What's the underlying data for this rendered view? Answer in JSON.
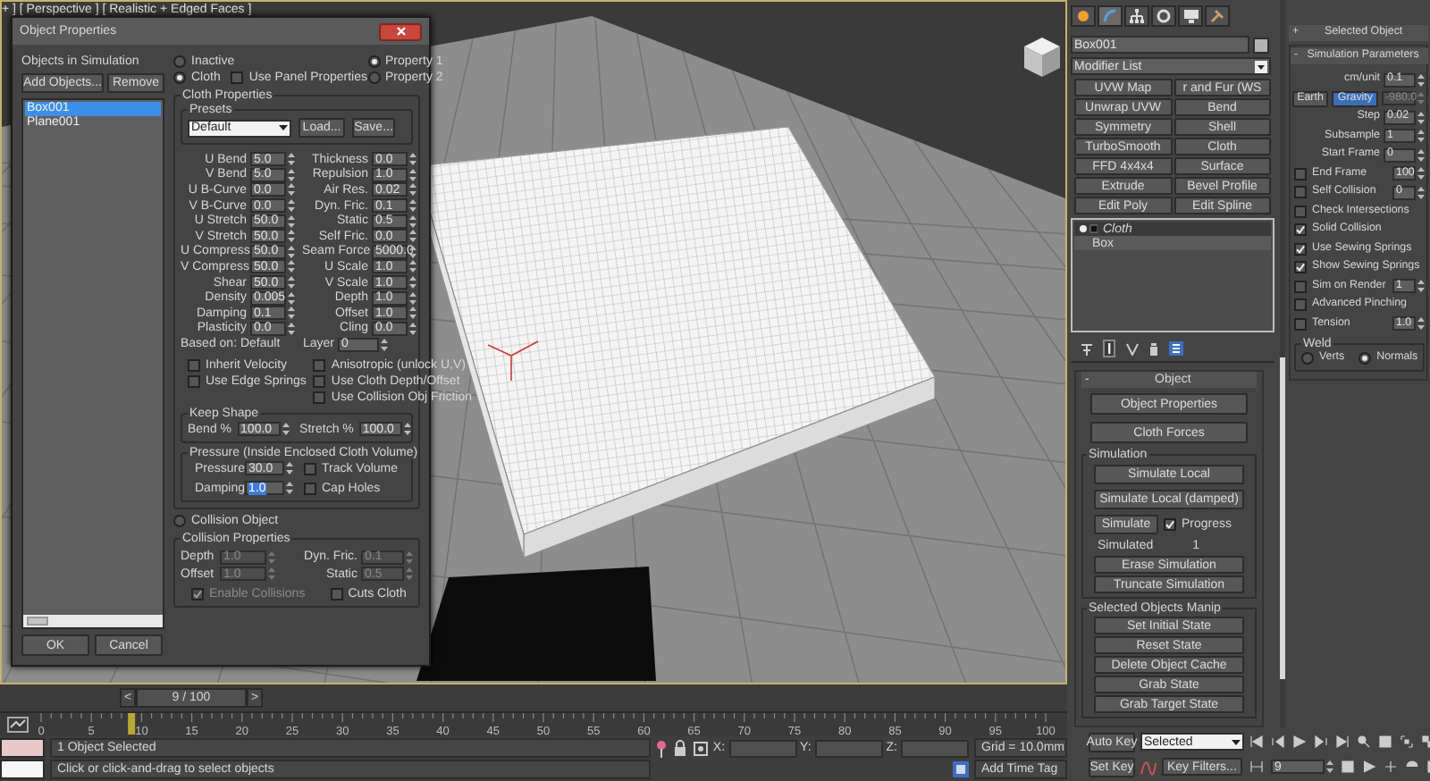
{
  "viewport": {
    "label": "+ ] [ Perspective ] [ Realistic + Edged Faces ]"
  },
  "dialog": {
    "title": "Object Properties",
    "objects_label": "Objects in Simulation",
    "add_button": "Add Objects...",
    "remove_button": "Remove",
    "objects": [
      {
        "label": "Box001",
        "selected": true
      },
      {
        "label": "Plane001",
        "selected": false
      }
    ],
    "ok": "OK",
    "cancel": "Cancel",
    "mode_options": [
      {
        "label": "Inactive",
        "selected": false
      },
      {
        "label": "Cloth",
        "selected": true
      }
    ],
    "use_panel_properties": {
      "label": "Use Panel Properties",
      "checked": false
    },
    "property_options": [
      {
        "label": "Property 1",
        "selected": true
      },
      {
        "label": "Property 2",
        "selected": false
      }
    ],
    "cloth_properties": {
      "title": "Cloth Properties",
      "presets_title": "Presets",
      "preset": "Default",
      "load": "Load...",
      "save": "Save...",
      "left_params": [
        {
          "label": "U Bend",
          "value": "5.0"
        },
        {
          "label": "V Bend",
          "value": "5.0"
        },
        {
          "label": "U B-Curve",
          "value": "0.0"
        },
        {
          "label": "V B-Curve",
          "value": "0.0"
        },
        {
          "label": "U Stretch",
          "value": "50.0"
        },
        {
          "label": "V Stretch",
          "value": "50.0"
        },
        {
          "label": "U Compress",
          "value": "50.0"
        },
        {
          "label": "V Compress",
          "value": "50.0"
        },
        {
          "label": "Shear",
          "value": "50.0"
        },
        {
          "label": "Density",
          "value": "0.005"
        },
        {
          "label": "Damping",
          "value": "0.1"
        },
        {
          "label": "Plasticity",
          "value": "0.0"
        }
      ],
      "right_params": [
        {
          "label": "Thickness",
          "value": "0.0"
        },
        {
          "label": "Repulsion",
          "value": "1.0"
        },
        {
          "label": "Air Res.",
          "value": "0.02"
        },
        {
          "label": "Dyn. Fric.",
          "value": "0.1"
        },
        {
          "label": "Static",
          "value": "0.5"
        },
        {
          "label": "Self Fric.",
          "value": "0.0"
        },
        {
          "label": "Seam Force",
          "value": "5000.0"
        },
        {
          "label": "U Scale",
          "value": "1.0"
        },
        {
          "label": "V Scale",
          "value": "1.0"
        },
        {
          "label": "Depth",
          "value": "1.0"
        },
        {
          "label": "Offset",
          "value": "1.0"
        },
        {
          "label": "Cling",
          "value": "0.0"
        }
      ],
      "based_on": "Based on: Default",
      "layer_label": "Layer",
      "layer_value": "0",
      "left_options": [
        {
          "label": "Inherit Velocity",
          "checked": false
        },
        {
          "label": "Use Edge Springs",
          "checked": false
        }
      ],
      "right_options": [
        {
          "label": "Anisotropic (unlock U,V)",
          "checked": false
        },
        {
          "label": "Use Cloth Depth/Offset",
          "checked": false
        },
        {
          "label": "Use Collision Obj Friction",
          "checked": false
        }
      ],
      "keep_shape": {
        "title": "Keep Shape",
        "bend_label": "Bend %",
        "bend": "100.0",
        "stretch_label": "Stretch %",
        "stretch": "100.0"
      },
      "pressure": {
        "title": "Pressure (Inside Enclosed Cloth Volume)",
        "pressure_label": "Pressure",
        "pressure": "30.0",
        "damping_label": "Damping",
        "damping": "1.0",
        "damping_focused": true,
        "track_volume": {
          "label": "Track Volume",
          "checked": false
        },
        "cap_holes": {
          "label": "Cap Holes",
          "checked": false
        }
      }
    },
    "collision_object": {
      "label": "Collision Object",
      "selected": false
    },
    "collision_properties": {
      "title": "Collision Properties",
      "disabled": true,
      "params": [
        {
          "label": "Depth",
          "value": "1.0"
        },
        {
          "label": "Dyn. Fric.",
          "value": "0.1"
        },
        {
          "label": "Offset",
          "value": "1.0"
        },
        {
          "label": "Static",
          "value": "0.5"
        }
      ],
      "enable_collisions": {
        "label": "Enable Collisions",
        "checked": true
      },
      "cuts_cloth": {
        "label": "Cuts Cloth",
        "checked": false
      }
    }
  },
  "command_panel": {
    "tabs": [
      {
        "kind": "create",
        "selected": false
      },
      {
        "kind": "modify",
        "selected": true
      },
      {
        "kind": "hierarchy",
        "selected": false
      },
      {
        "kind": "motion",
        "selected": false
      },
      {
        "kind": "display",
        "selected": false
      },
      {
        "kind": "utilities",
        "selected": false
      }
    ],
    "object_name": "Box001",
    "modifier_list": "Modifier List",
    "modifier_buttons": [
      "UVW Map",
      "r and Fur (WS",
      "Unwrap UVW",
      "Bend",
      "Symmetry",
      "Shell",
      "TurboSmooth",
      "Cloth",
      "FFD 4x4x4",
      "Surface",
      "Extrude",
      "Bevel Profile",
      "Edit Poly",
      "Edit Spline"
    ],
    "stack": [
      {
        "label": "Cloth",
        "kind": "modifier"
      },
      {
        "label": "Box",
        "kind": "base"
      }
    ],
    "object_rollout": {
      "sign": "-",
      "title": "Object",
      "buttons": [
        "Object Properties",
        "Cloth Forces"
      ],
      "simulation_title": "Simulation",
      "simulate_local": "Simulate Local",
      "simulate_local_damped": "Simulate Local (damped)",
      "simulate": "Simulate",
      "progress": {
        "label": "Progress",
        "checked": true
      },
      "simulated_label": "Simulated",
      "simulated_value": "1",
      "sim_buttons": [
        "Erase Simulation",
        "Truncate Simulation"
      ],
      "manip_title": "Selected Objects Manip",
      "manip_buttons": [
        "Set Initial State",
        "Reset State",
        "Delete Object Cache",
        "Grab State",
        "Grab Target State"
      ]
    }
  },
  "sim_params": {
    "selected_object": {
      "sign": "+",
      "title": "Selected Object"
    },
    "sign": "-",
    "title": "Simulation Parameters",
    "cm_label": "cm/unit",
    "cm_value": "0.1",
    "earth": "Earth",
    "gravity": "Gravity",
    "gravity_on": true,
    "gravity_value": "-980.0",
    "rows": [
      {
        "kind": "spinner",
        "label": "Step",
        "value": "0.02"
      },
      {
        "kind": "spinner",
        "label": "Subsample",
        "value": "1"
      },
      {
        "kind": "spinner",
        "label": "Start Frame",
        "value": "0"
      },
      {
        "kind": "check_spinner",
        "label": "End Frame",
        "checked": false,
        "value": "100"
      },
      {
        "kind": "check_spinner",
        "label": "Self Collision",
        "checked": false,
        "value": "0"
      },
      {
        "kind": "check",
        "label": "Check Intersections",
        "checked": false
      },
      {
        "kind": "check",
        "label": "Solid Collision",
        "checked": true
      },
      {
        "kind": "check",
        "label": "Use Sewing Springs",
        "checked": true
      },
      {
        "kind": "check",
        "label": "Show Sewing Springs",
        "checked": true
      },
      {
        "kind": "check_spinner",
        "label": "Sim on Render",
        "checked": false,
        "value": "1"
      },
      {
        "kind": "check",
        "label": "Advanced Pinching",
        "checked": false
      },
      {
        "kind": "check_spinner",
        "label": "Tension",
        "checked": false,
        "value": "1.0"
      }
    ],
    "weld": {
      "title": "Weld",
      "options": [
        {
          "label": "Verts",
          "selected": false
        },
        {
          "label": "Normals",
          "selected": true
        }
      ]
    }
  },
  "time_slider": {
    "prev": "<",
    "position": "9 / 100",
    "next": ">",
    "level": 0.09,
    "ticks": [
      "0",
      "5",
      "10",
      "15",
      "20",
      "25",
      "30",
      "35",
      "40",
      "45",
      "50",
      "55",
      "60",
      "65",
      "70",
      "75",
      "80",
      "85",
      "90",
      "95",
      "100"
    ]
  },
  "status": {
    "selection": "1 Object Selected",
    "prompt": "Click or click-and-drag to select objects",
    "x_label": "X:",
    "y_label": "Y:",
    "z_label": "Z:",
    "grid": "Grid = 10.0mm",
    "add_time_tag": "Add Time Tag"
  },
  "animation": {
    "auto_key": "Auto Key",
    "key_mode": "Selected",
    "set_key": "Set Key",
    "key_filters": "Key Filters...",
    "frame": "9"
  }
}
